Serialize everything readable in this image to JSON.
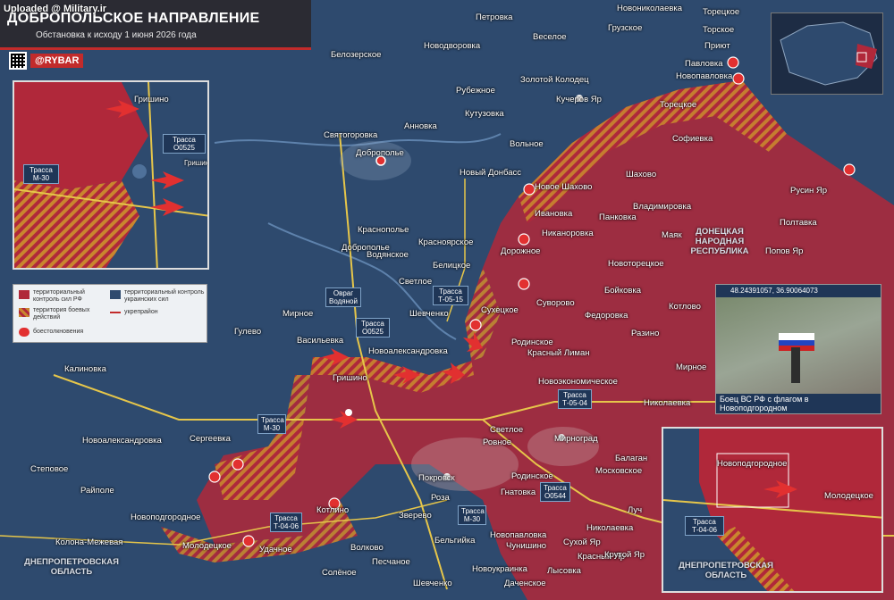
{
  "watermark": "Uploaded @ Military.ir",
  "header": {
    "title": "ДОБРОПОЛЬСКОЕ НАПРАВЛЕНИЕ",
    "subtitle": "Обстановка к исходу 1 июня 2026 года"
  },
  "brand": {
    "handle": "@RYBAR",
    "icon": "telegram-icon"
  },
  "colors": {
    "ru_control": "#b0283a",
    "contested": "#e8a33a",
    "ua_control": "#2e4a6e",
    "road": "#e6c64a",
    "accent": "#c22b2b"
  },
  "legend": {
    "ru": "территориальный контроль сил РФ",
    "contested": "территория боевых действий",
    "ua": "территориальный контроль украинских сил",
    "fortified": "укрепрайон",
    "clashes": "боестолкновения"
  },
  "photo": {
    "coords": "48.24391057, 36.90064073",
    "caption": "Боец ВС РФ с флагом в Новоподгородном"
  },
  "inset1": {
    "places": [
      "Гришино",
      "Трасса О0525",
      "Трасса М-30",
      "Гришинка"
    ]
  },
  "inset2": {
    "places": [
      "Новоподгородное",
      "Молодецкое",
      "Трасса Т-04-06",
      "ДНЕПРОПЕТРОВСКАЯ ОБЛАСТЬ"
    ]
  },
  "regions": {
    "dnr": "ДОНЕЦКАЯ НАРОДНАЯ РЕСПУБЛИКА",
    "dnepr": "ДНЕПРОПЕТРОВСКАЯ ОБЛАСТЬ"
  },
  "roads": [
    {
      "id": "o0525a",
      "text": "Трасса О0525"
    },
    {
      "id": "m30a",
      "text": "Трасса М-30"
    },
    {
      "id": "t0515",
      "text": "Трасса Т-05-15"
    },
    {
      "id": "o0525b",
      "text": "Трасса О0525"
    },
    {
      "id": "m30b",
      "text": "Трасса М-30"
    },
    {
      "id": "t0504",
      "text": "Трасса Т-05-04"
    },
    {
      "id": "o0544",
      "text": "Трасса О0544"
    },
    {
      "id": "m30c",
      "text": "Трасса М-30"
    },
    {
      "id": "t0406",
      "text": "Трасса Т-04-06"
    },
    {
      "id": "ovrag",
      "text": "Овраг Водяной"
    }
  ],
  "places": [
    "Новониколаевка",
    "Торецкое",
    "Петровка",
    "Грузское",
    "Торское",
    "Веселое",
    "Новодворовка",
    "Приют",
    "Белозерское",
    "Павловка",
    "Золотой Колодец",
    "Рубежное",
    "Новопавловка",
    "Кучеров Яр",
    "Кутузовка",
    "Анновка",
    "Торецкое",
    "Святогоровка",
    "Софиевка",
    "Доброполье",
    "Вольное",
    "Новый Донбасс",
    "Новое Шахово",
    "Шахово",
    "Ивановка",
    "Русин Яр",
    "Владимировка",
    "Панковка",
    "Полтавка",
    "Краснополье",
    "Никаноровка",
    "Маяк",
    "Добропольe",
    "Красноярское",
    "Водянское",
    "Попов Яр",
    "Белицкое",
    "Дорожное",
    "Новоторецкое",
    "Светлое",
    "Бойковка",
    "Мирное",
    "Котлово",
    "Сухецкое",
    "Суворово",
    "Федоровка",
    "Шевченко",
    "Гулево",
    "Разино",
    "Васильевка",
    "Родинское",
    "Новоалександровка",
    "Красный Лиман",
    "Новоэкономическое",
    "Мирное",
    "Калиновка",
    "Гришино",
    "Николаевка",
    "Светлое",
    "Ровное",
    "Новоалександровка",
    "Сергеевка",
    "Мирноград",
    "Балаган",
    "Степовое",
    "Покровск",
    "Московское",
    "Родинское",
    "Райполе",
    "Роза",
    "Гнатовка",
    "Луч",
    "Новоподгородное",
    "Котлино",
    "Зверево",
    "Николаевка",
    "Колона-Межевая",
    "Молодецкое",
    "Бельгийка",
    "Новопавловка",
    "Сухой Яр",
    "Удачное",
    "Волково",
    "Чунишино",
    "Красный Яр",
    "Крутой Яр",
    "Песчаное",
    "Солёное",
    "Новоукраинка",
    "Лысовка",
    "Шевченко",
    "Даченское"
  ]
}
